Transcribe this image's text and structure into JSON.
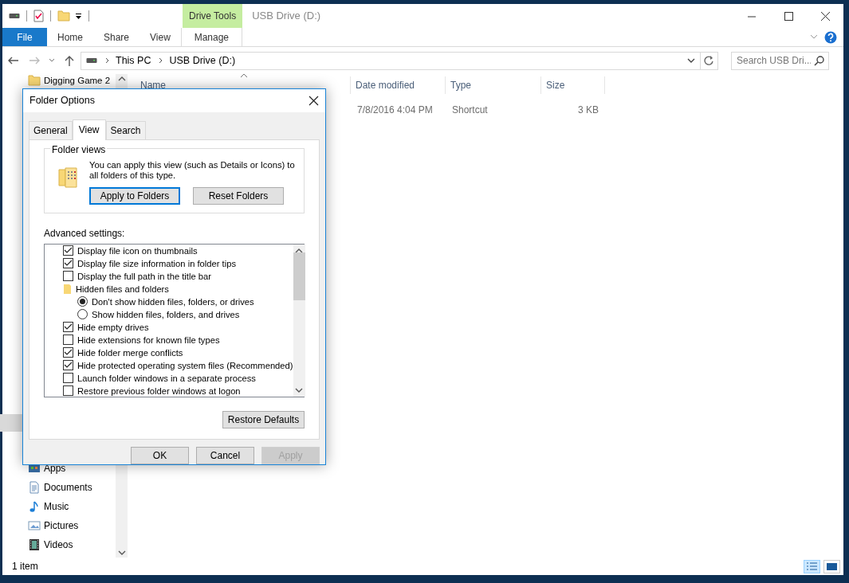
{
  "title_bar": {
    "context_tab": "Drive Tools",
    "title": "USB Drive (D:)"
  },
  "ribbon_tabs": [
    {
      "label": "File",
      "kind": "file"
    },
    {
      "label": "Home",
      "kind": "normal"
    },
    {
      "label": "Share",
      "kind": "normal"
    },
    {
      "label": "View",
      "kind": "normal"
    },
    {
      "label": "Manage",
      "kind": "context"
    }
  ],
  "address_bar": {
    "path": [
      "This PC",
      "USB Drive (D:)"
    ]
  },
  "search": {
    "placeholder": "Search USB Dri..."
  },
  "navigation": {
    "items": [
      {
        "label": "Digging Game 2",
        "kind": "folder"
      },
      {
        "label": "Apps",
        "kind": "apps"
      },
      {
        "label": "Documents",
        "kind": "documents"
      },
      {
        "label": "Music",
        "kind": "music"
      },
      {
        "label": "Pictures",
        "kind": "pictures"
      },
      {
        "label": "Videos",
        "kind": "videos"
      }
    ]
  },
  "file_list": {
    "columns": [
      "Name",
      "Date modified",
      "Type",
      "Size"
    ],
    "rows": [
      {
        "date_modified": "7/8/2016 4:04 PM",
        "type": "Shortcut",
        "size": "3 KB"
      }
    ]
  },
  "status_bar": {
    "text": "1 item"
  },
  "dialog": {
    "title": "Folder Options",
    "tabs": [
      {
        "label": "General",
        "selected": false
      },
      {
        "label": "View",
        "selected": true
      },
      {
        "label": "Search",
        "selected": false
      }
    ],
    "folder_views": {
      "legend": "Folder views",
      "text": "You can apply this view (such as Details or Icons) to all folders of this type.",
      "buttons": [
        {
          "label": "Apply to Folders",
          "default": true
        },
        {
          "label": "Reset Folders",
          "default": false
        }
      ]
    },
    "advanced_label": "Advanced settings:",
    "settings": [
      {
        "kind": "checkbox",
        "label": "Display file icon on thumbnails",
        "checked": true
      },
      {
        "kind": "checkbox",
        "label": "Display file size information in folder tips",
        "checked": true
      },
      {
        "kind": "checkbox",
        "label": "Display the full path in the title bar",
        "checked": false
      },
      {
        "kind": "folder",
        "label": "Hidden files and folders",
        "children": [
          {
            "kind": "radio",
            "label": "Don't show hidden files, folders, or drives",
            "selected": true
          },
          {
            "kind": "radio",
            "label": "Show hidden files, folders, and drives",
            "selected": false
          }
        ]
      },
      {
        "kind": "checkbox",
        "label": "Hide empty drives",
        "checked": true
      },
      {
        "kind": "checkbox",
        "label": "Hide extensions for known file types",
        "checked": false
      },
      {
        "kind": "checkbox",
        "label": "Hide folder merge conflicts",
        "checked": true
      },
      {
        "kind": "checkbox",
        "label": "Hide protected operating system files (Recommended)",
        "checked": true
      },
      {
        "kind": "checkbox",
        "label": "Launch folder windows in a separate process",
        "checked": false
      },
      {
        "kind": "checkbox",
        "label": "Restore previous folder windows at logon",
        "checked": false
      }
    ],
    "restore_button": "Restore Defaults",
    "buttons": [
      {
        "label": "OK",
        "disabled": false
      },
      {
        "label": "Cancel",
        "disabled": false
      },
      {
        "label": "Apply",
        "disabled": true
      }
    ]
  }
}
